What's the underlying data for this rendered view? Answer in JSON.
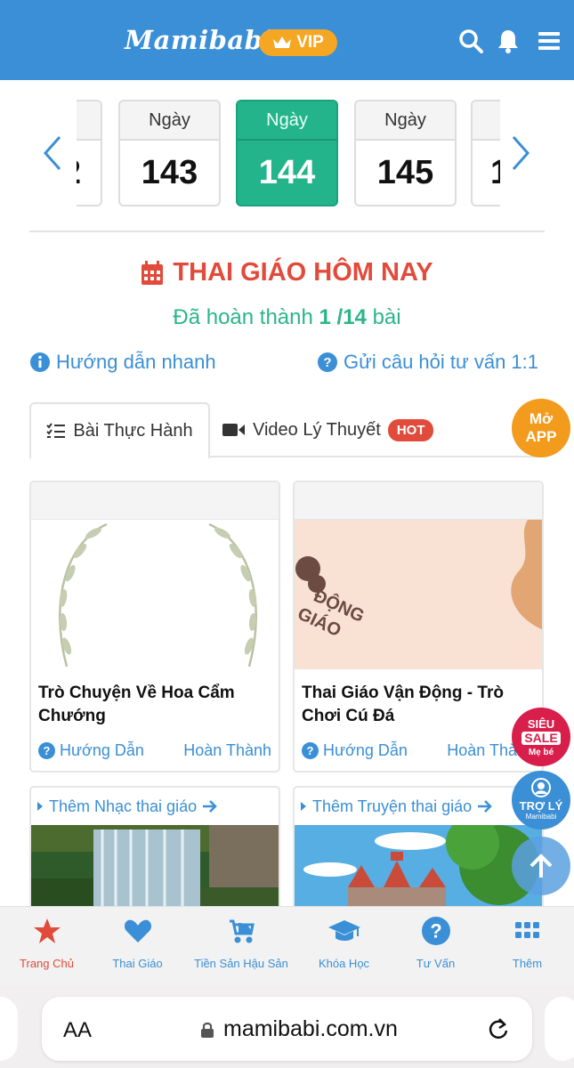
{
  "header": {
    "logo": "Mamibabi",
    "vip_label": "VIP",
    "brand_color": "#3a8fd6",
    "icons": [
      "search-icon",
      "bell-icon",
      "menu-icon"
    ]
  },
  "days": {
    "items": [
      {
        "label": "",
        "number": "2"
      },
      {
        "label": "Ngày",
        "number": "143"
      },
      {
        "label": "Ngày",
        "number": "144",
        "active": true
      },
      {
        "label": "Ngày",
        "number": "145"
      },
      {
        "label": "",
        "number": "1"
      }
    ]
  },
  "section": {
    "title": "THAI GIÁO HÔM NAY",
    "progress_prefix": "Đã hoàn thành",
    "progress_value": "1 /14",
    "progress_suffix": "bài",
    "quick_guide": "Hướng dẫn nhanh",
    "ask": "Gửi câu hỏi tư vấn 1:1"
  },
  "tabs": {
    "practice": "Bài Thực Hành",
    "video": "Video Lý Thuyết",
    "hot": "HOT",
    "open_app_line1": "Mở",
    "open_app_line2": "APP"
  },
  "cards": [
    {
      "title": "Trò Chuyện Về Hoa Cẩm Chướng",
      "guide": "Hướng Dẫn",
      "done": "Hoàn Thành"
    },
    {
      "title": "Thai Giáo Vận Động - Trò Chơi Cú Đá",
      "guide": "Hướng Dẫn",
      "done": "Hoàn Thành",
      "image_text_1": "ĐỘNG",
      "image_text_2": "GIÁO"
    }
  ],
  "more": [
    {
      "label": "Thêm Nhạc thai giáo"
    },
    {
      "label": "Thêm Truyện thai giáo"
    }
  ],
  "floating": {
    "sale_top": "SIÊU",
    "sale_mid": "SALE",
    "sale_bottom": "Mẹ bé",
    "assistant": "TRỢ LÝ",
    "assistant_sub": "Mamibabi"
  },
  "bottom_nav": [
    {
      "label": "Trang Chủ",
      "icon": "star-icon",
      "active": true
    },
    {
      "label": "Thai Giáo",
      "icon": "heart-icon"
    },
    {
      "label": "Tiền Sản Hậu Sản",
      "icon": "stroller-icon"
    },
    {
      "label": "Khóa Học",
      "icon": "graduation-cap-icon"
    },
    {
      "label": "Tư Vấn",
      "icon": "question-icon"
    },
    {
      "label": "Thêm",
      "icon": "grid-icon"
    }
  ],
  "browser": {
    "aa": "AA",
    "url": "mamibabi.com.vn"
  }
}
